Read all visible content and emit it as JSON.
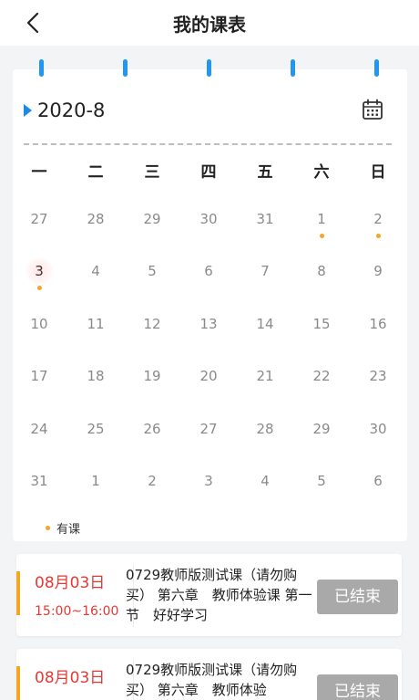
{
  "header": {
    "title": "我的课表"
  },
  "calendar": {
    "month": "2020-8",
    "weekdays": [
      "一",
      "二",
      "三",
      "四",
      "五",
      "六",
      "日"
    ],
    "weeks": [
      [
        "27",
        "28",
        "29",
        "30",
        "31",
        "1",
        "2"
      ],
      [
        "3",
        "4",
        "5",
        "6",
        "7",
        "8",
        "9"
      ],
      [
        "10",
        "11",
        "12",
        "13",
        "14",
        "15",
        "16"
      ],
      [
        "17",
        "18",
        "19",
        "20",
        "21",
        "22",
        "23"
      ],
      [
        "24",
        "25",
        "26",
        "27",
        "28",
        "29",
        "30"
      ],
      [
        "31",
        "1",
        "2",
        "3",
        "4",
        "5",
        "6"
      ]
    ],
    "legend": "有课",
    "dot_color": "#f5a623",
    "accent": "#1e88e5"
  },
  "courses": [
    {
      "date": "08月03日",
      "time": "15:00~16:00",
      "title": "0729教师版测试课（请勿购买） 第六章　教师体验课 第一节　好好学习",
      "status": "已结束"
    },
    {
      "date": "08月03日",
      "time": "",
      "title": "0729教师版测试课（请勿购买） 第六章　教师体验",
      "status": "已结束"
    }
  ],
  "colors": {
    "date_red": "#e53935",
    "status_gray": "#a9a9a9",
    "bar_orange": "#f5a623"
  }
}
